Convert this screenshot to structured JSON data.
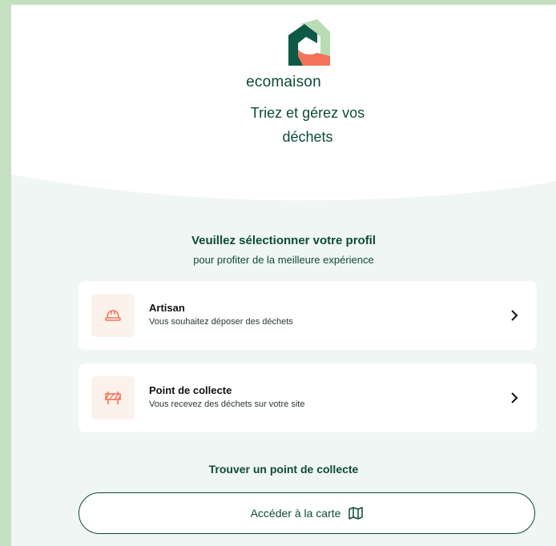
{
  "brand": {
    "name": "ecomaison",
    "tagline": "Triez et gérez vos déchets",
    "colors": {
      "primary": "#0d4a3b",
      "accent": "#f3735a",
      "light_green": "#c5e0c1"
    }
  },
  "profile": {
    "title": "Veuillez sélectionner votre profil",
    "subtitle": "pour profiter de la meilleure expérience",
    "options": [
      {
        "icon": "hard-hat-icon",
        "label": "Artisan",
        "description": "Vous souhaitez déposer des déchets"
      },
      {
        "icon": "barrier-icon",
        "label": "Point de collecte",
        "description": "Vous recevez des déchets sur votre site"
      }
    ]
  },
  "finder": {
    "title": "Trouver un point de collecte",
    "button_label": "Accéder à la carte",
    "button_icon": "map-icon"
  }
}
